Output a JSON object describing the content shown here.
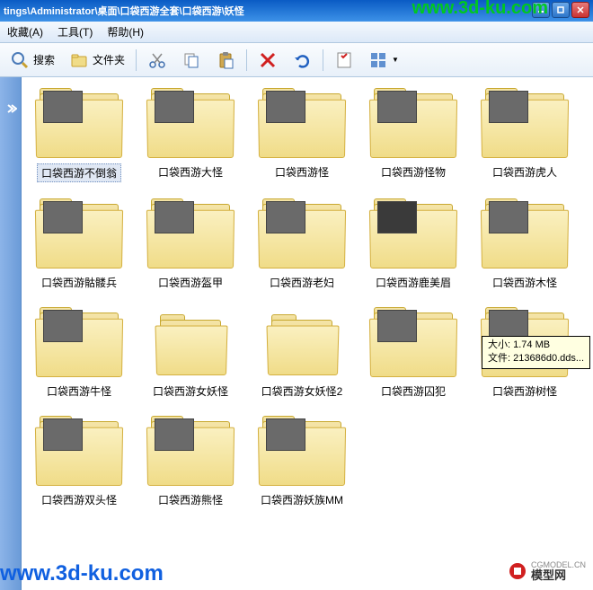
{
  "titlebar": {
    "path": "tings\\Administrator\\桌面\\口袋西游全套\\口袋西游\\妖怪"
  },
  "watermarks": {
    "top": "www.3d-ku.com",
    "bottom": "www.3d-ku.com",
    "cg_cn": "模型网",
    "cg_url": "CGMODEL.CN"
  },
  "menubar": {
    "favorites": "收藏(A)",
    "tools": "工具(T)",
    "help": "帮助(H)"
  },
  "toolbar": {
    "search": "搜索",
    "folders": "文件夹"
  },
  "folders": [
    {
      "name": "口袋西游不倒翁",
      "thumb": true,
      "selected": true
    },
    {
      "name": "口袋西游大怪",
      "thumb": true
    },
    {
      "name": "口袋西游怪",
      "thumb": true
    },
    {
      "name": "口袋西游怪物",
      "thumb": true
    },
    {
      "name": "口袋西游虎人",
      "thumb": true
    },
    {
      "name": "口袋西游骷髅兵",
      "thumb": true
    },
    {
      "name": "口袋西游盔甲",
      "thumb": true
    },
    {
      "name": "口袋西游老妇",
      "thumb": true
    },
    {
      "name": "口袋西游鹿美眉",
      "thumb": true,
      "darkthumb": true
    },
    {
      "name": "口袋西游木怪",
      "thumb": true
    },
    {
      "name": "口袋西游牛怪",
      "thumb": true
    },
    {
      "name": "口袋西游女妖怪",
      "thumb": false
    },
    {
      "name": "口袋西游女妖怪2",
      "thumb": false
    },
    {
      "name": "口袋西游囚犯",
      "thumb": true
    },
    {
      "name": "口袋西游树怪",
      "thumb": true
    },
    {
      "name": "口袋西游双头怪",
      "thumb": true
    },
    {
      "name": "口袋西游熊怪",
      "thumb": true
    },
    {
      "name": "口袋西游妖族MM",
      "thumb": true
    }
  ],
  "tooltip": {
    "size_label": "大小:",
    "size_value": "1.74 MB",
    "file_label": "文件:",
    "file_value": "213686d0.dds..."
  }
}
